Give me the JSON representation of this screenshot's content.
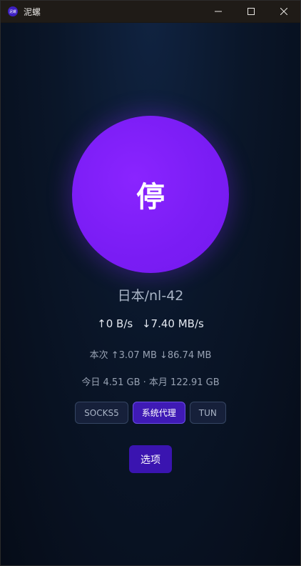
{
  "window": {
    "title": "泥螺",
    "icon_text": "泥螺"
  },
  "main": {
    "power_label": "停",
    "server": "日本/nl-42",
    "speed": {
      "upload": "↑0 B/s",
      "download": "↓7.40 MB/s"
    },
    "session": "本次 ↑3.07 MB ↓86.74 MB",
    "totals": "今日 4.51 GB · 本月 122.91 GB",
    "modes": [
      {
        "label": "SOCKS5",
        "active": false
      },
      {
        "label": "系统代理",
        "active": true
      },
      {
        "label": "TUN",
        "active": false
      }
    ],
    "options_label": "选项"
  },
  "colors": {
    "accent": "#7b1df5",
    "active_mode": "#3f1ab5",
    "background": "#07101f"
  }
}
